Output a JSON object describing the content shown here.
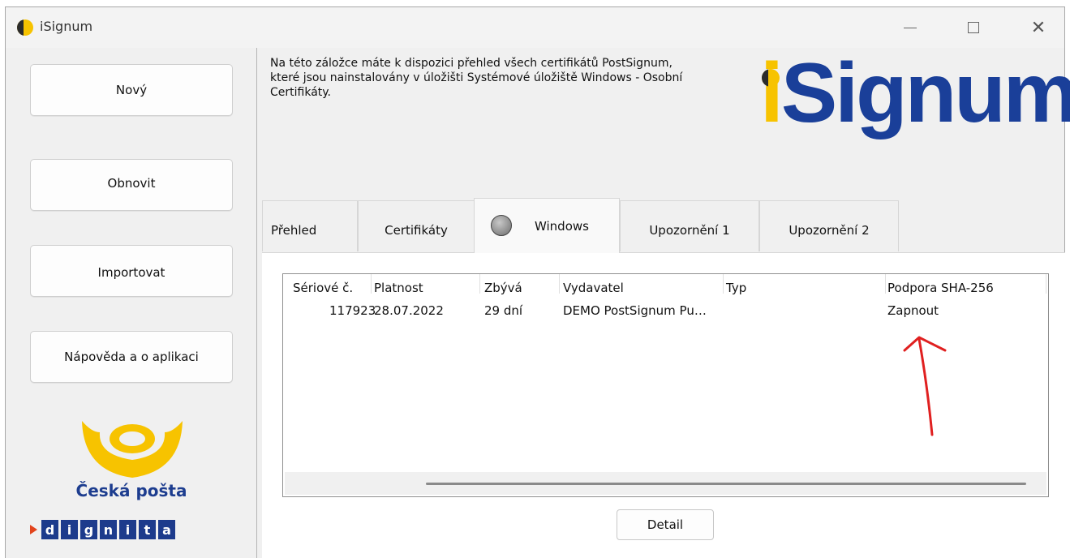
{
  "window": {
    "title": "iSignum"
  },
  "sidebar": {
    "buttons": {
      "new": "Nový",
      "refresh": "Obnovit",
      "import": "Importovat",
      "help": "Nápověda a o aplikaci"
    },
    "ceska_posta": "Česká pošta",
    "dignita_letters": [
      "d",
      "i",
      "g",
      "n",
      "i",
      "t",
      "a"
    ]
  },
  "header": {
    "description": "Na této záložce máte k dispozici přehled všech certifikátů PostSignum,\nkteré jsou nainstalovány v úložišti Systémové úložiště Windows - Osobní\nCertifikáty.",
    "brand": {
      "i": "i",
      "rest": "Signum"
    }
  },
  "tabs": {
    "overview": "Přehled",
    "certificates": "Certifikáty",
    "windows": "Windows",
    "warning1": "Upozornění 1",
    "warning2": "Upozornění 2"
  },
  "table": {
    "columns": {
      "serial": "Sériové č.",
      "validity": "Platnost",
      "remaining": "Zbývá",
      "issuer": "Vydavatel",
      "type": "Typ",
      "sha": "Podpora SHA-256"
    },
    "rows": [
      {
        "serial": "117923",
        "validity": "28.07.2022",
        "remaining": "29 dní",
        "issuer": "DEMO PostSignum Pu…",
        "type": "",
        "sha": "Zapnout"
      }
    ]
  },
  "actions": {
    "detail": "Detail"
  },
  "colors": {
    "brand_blue": "#1a3f99",
    "brand_yellow": "#f7c300",
    "annotation_red": "#e02020"
  }
}
